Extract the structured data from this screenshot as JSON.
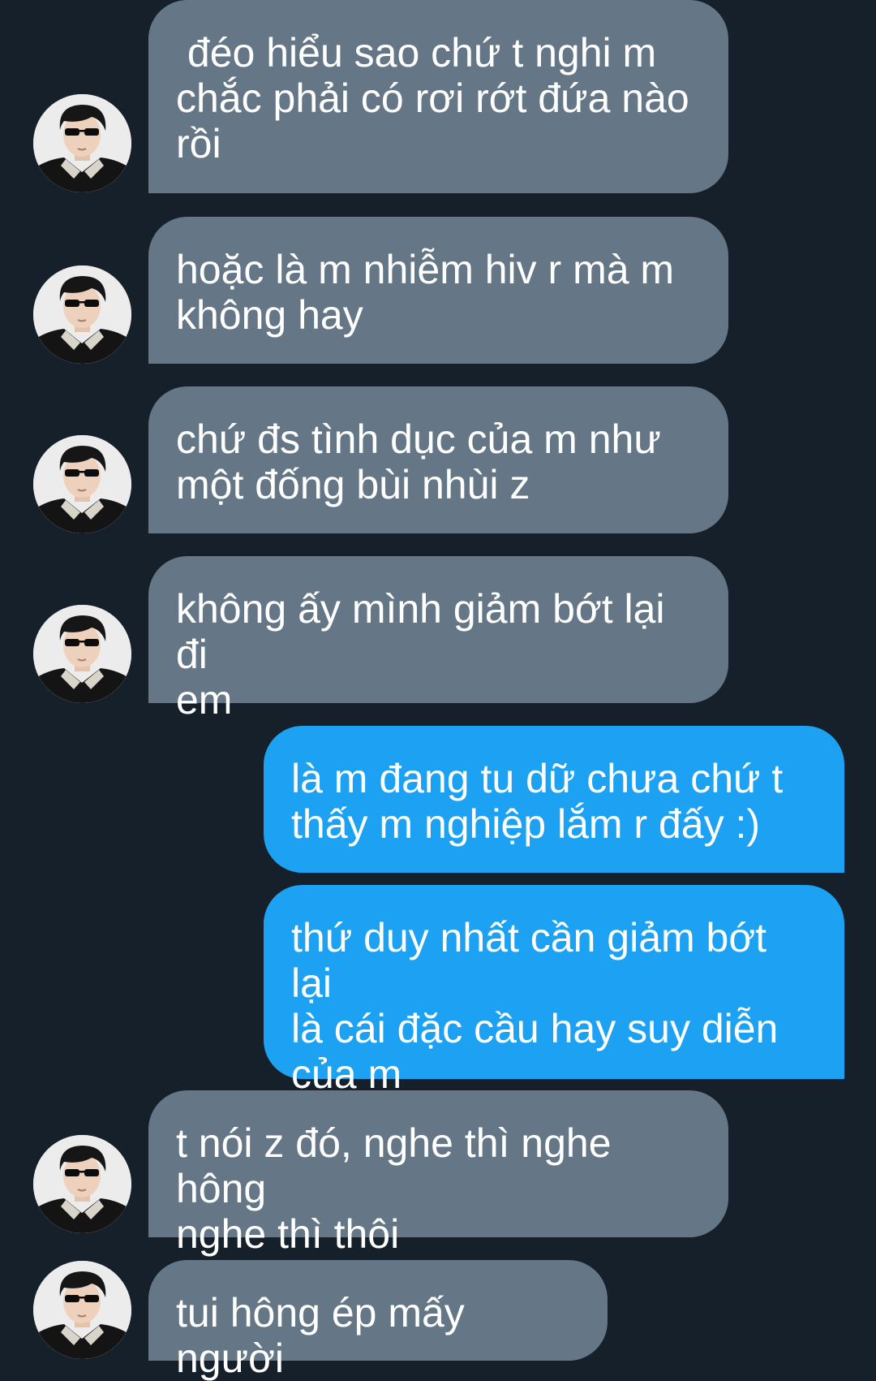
{
  "conversation": {
    "messages": [
      {
        "sender": "other",
        "text": " đéo hiểu sao chứ t nghi m\nchắc phải có rơi rớt đứa nào\nrồi",
        "avatar_icon": "user-avatar-icon"
      },
      {
        "sender": "other",
        "text": "hoặc là m nhiễm hiv r mà m\nkhông hay",
        "avatar_icon": "user-avatar-icon"
      },
      {
        "sender": "other",
        "text": "chứ đs tình dục của m như\nmột đống bùi nhùi z",
        "avatar_icon": "user-avatar-icon"
      },
      {
        "sender": "other",
        "text": "không ấy mình giảm bớt lại đi\nem",
        "avatar_icon": "user-avatar-icon"
      },
      {
        "sender": "me",
        "text": "là m đang tu dữ chưa chứ t\nthấy m nghiệp lắm r đấy :)"
      },
      {
        "sender": "me",
        "text": "thứ duy nhất cần giảm bớt lại\nlà cái đặc cầu hay suy diễn\ncủa m"
      },
      {
        "sender": "other",
        "text": "t nói z đó, nghe thì nghe hông\nnghe thì thôi",
        "avatar_icon": "user-avatar-icon"
      },
      {
        "sender": "other",
        "text": "tui hông ép mấy người",
        "avatar_icon": "user-avatar-icon"
      }
    ]
  },
  "colors": {
    "background": "#15202b",
    "received_bubble": "#657786",
    "sent_bubble": "#1da1f2",
    "text": "#ffffff"
  }
}
